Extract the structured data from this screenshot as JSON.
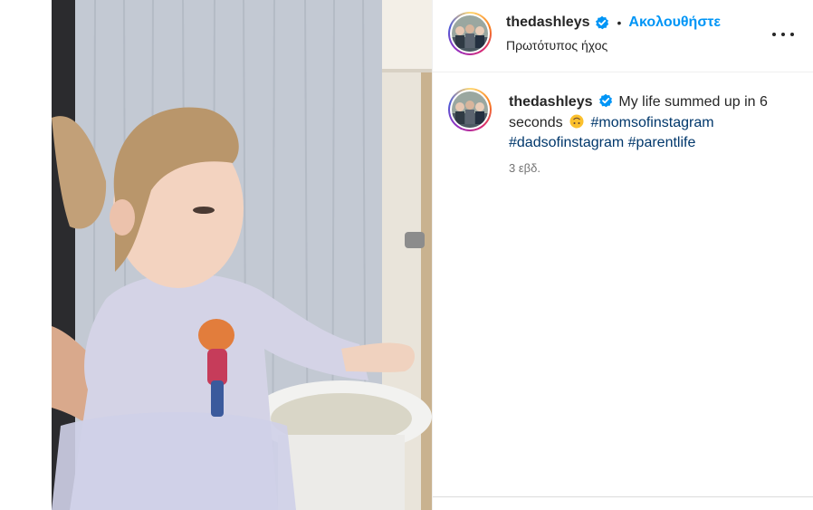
{
  "post": {
    "username": "thedashleys",
    "follow_label": "Ακολουθήστε",
    "audio_label": "Πρωτότυπος ήχος",
    "separator": "•"
  },
  "caption": {
    "username": "thedashleys",
    "text_part1": "My life summed up in 6 seconds",
    "hashtags": [
      "#momsofinstagram",
      "#dadsofinstagram",
      "#parentlife"
    ],
    "time": "3 εβδ."
  },
  "icons": {
    "verified": "verified-badge-icon",
    "more": "more-options-icon",
    "emoji": "upside-down-face-emoji"
  },
  "colors": {
    "follow_blue": "#0095f6",
    "hashtag": "#00376b",
    "verified": "#0095f6",
    "muted": "#737373"
  }
}
